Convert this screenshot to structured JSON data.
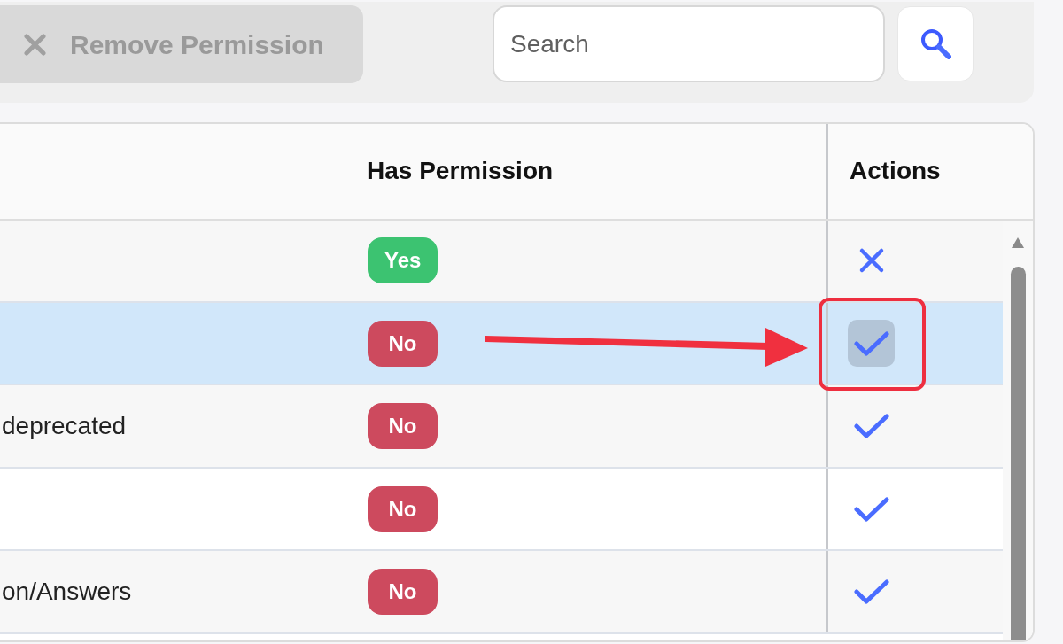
{
  "toolbar": {
    "remove_button": {
      "label": "Remove Permission",
      "disabled": true
    },
    "search": {
      "placeholder": "Search"
    }
  },
  "table": {
    "header": {
      "has_permission": "Has Permission",
      "actions": "Actions"
    },
    "rows": [
      {
        "selected": false,
        "has_permission": {
          "label": "Yes",
          "granted": true
        },
        "action": {
          "kind": "revoke",
          "focused": false
        },
        "callout": false
      },
      {
        "selected": true,
        "has_permission": {
          "label": "No",
          "granted": false
        },
        "action": {
          "kind": "grant",
          "focused": true
        },
        "callout": true
      },
      {
        "selected": false,
        "column_1": "deprecated",
        "has_permission": {
          "label": "No",
          "granted": false
        },
        "action": {
          "kind": "grant",
          "focused": false
        },
        "callout": false
      },
      {
        "selected": false,
        "has_permission": {
          "label": "No",
          "granted": false
        },
        "action": {
          "kind": "grant",
          "focused": false
        },
        "callout": false
      },
      {
        "selected": false,
        "column_1": "on/Answers",
        "has_permission": {
          "label": "No",
          "granted": false
        },
        "action": {
          "kind": "grant",
          "focused": false
        },
        "callout": false
      }
    ]
  }
}
